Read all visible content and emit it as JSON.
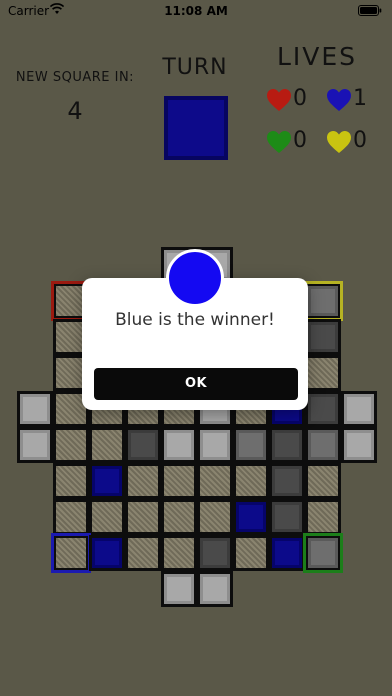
{
  "status_bar": {
    "carrier": "Carrier",
    "time": "11:08 AM"
  },
  "header": {
    "new_square_label": "NEW SQUARE IN:",
    "new_square_value": "4",
    "turn_label": "TURN",
    "turn_color": "#0d0a8a",
    "lives_label": "LIVES",
    "lives": [
      {
        "player": "red",
        "color": "#b81b12",
        "count": "0"
      },
      {
        "player": "blue",
        "color": "#1a12b5",
        "count": "1"
      },
      {
        "player": "green",
        "color": "#1d8b17",
        "count": "0"
      },
      {
        "player": "yellow",
        "color": "#c9c411",
        "count": "0"
      }
    ]
  },
  "board": {
    "rows": [
      [
        "",
        "",
        "",
        "",
        "light",
        "light",
        "",
        "",
        "",
        ""
      ],
      [
        "",
        "hatch",
        "hatch",
        "hatch",
        "hatch",
        "hatch",
        "hatch",
        "hatch",
        "mid",
        ""
      ],
      [
        "",
        "hatch",
        "hatch",
        "hatch",
        "hatch",
        "hatch",
        "hatch",
        "hatch",
        "dark",
        ""
      ],
      [
        "",
        "hatch",
        "hatch",
        "hatch",
        "hatch",
        "hatch",
        "hatch",
        "hatch",
        "hatch",
        ""
      ],
      [
        "light",
        "hatch",
        "hatch",
        "hatch",
        "hatch",
        "light",
        "hatch",
        "blue",
        "dark",
        "light"
      ],
      [
        "light",
        "hatch",
        "hatch",
        "dark",
        "light",
        "light",
        "mid",
        "dark",
        "mid",
        "light"
      ],
      [
        "",
        "hatch",
        "blue",
        "hatch",
        "hatch",
        "hatch",
        "hatch",
        "dark",
        "hatch",
        ""
      ],
      [
        "",
        "hatch",
        "hatch",
        "hatch",
        "hatch",
        "hatch",
        "blue",
        "dark",
        "hatch",
        ""
      ],
      [
        "",
        "hatch",
        "blue",
        "hatch",
        "hatch",
        "dark",
        "hatch",
        "blue",
        "mid",
        ""
      ],
      [
        "",
        "",
        "",
        "",
        "light",
        "light",
        "",
        "",
        "",
        ""
      ]
    ]
  },
  "alert": {
    "winner_color": "#1409f2",
    "message": "Blue is the winner!",
    "ok_label": "OK"
  }
}
